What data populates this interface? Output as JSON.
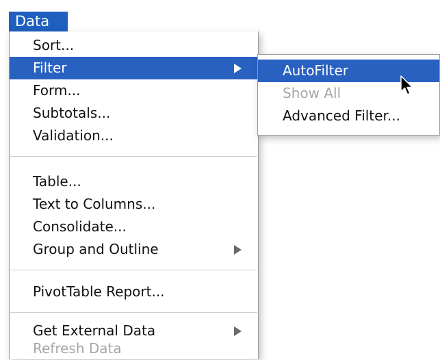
{
  "menubar": {
    "title": "Data"
  },
  "menu": {
    "items": [
      {
        "label": "Sort..."
      },
      {
        "label": "Filter"
      },
      {
        "label": "Form..."
      },
      {
        "label": "Subtotals..."
      },
      {
        "label": "Validation..."
      },
      {
        "label": "Table..."
      },
      {
        "label": "Text to Columns..."
      },
      {
        "label": "Consolidate..."
      },
      {
        "label": "Group and Outline"
      },
      {
        "label": "PivotTable Report..."
      },
      {
        "label": "Get External Data"
      },
      {
        "label": "Refresh Data"
      }
    ]
  },
  "submenu": {
    "items": [
      {
        "label": "AutoFilter"
      },
      {
        "label": "Show All"
      },
      {
        "label": "Advanced Filter..."
      }
    ]
  },
  "colors": {
    "selection": "#2961c1",
    "menubar_highlight": "#1f5fbf",
    "disabled_text": "#a6a6a6"
  },
  "icons": [
    "submenu-arrow-icon",
    "mouse-pointer-icon"
  ]
}
